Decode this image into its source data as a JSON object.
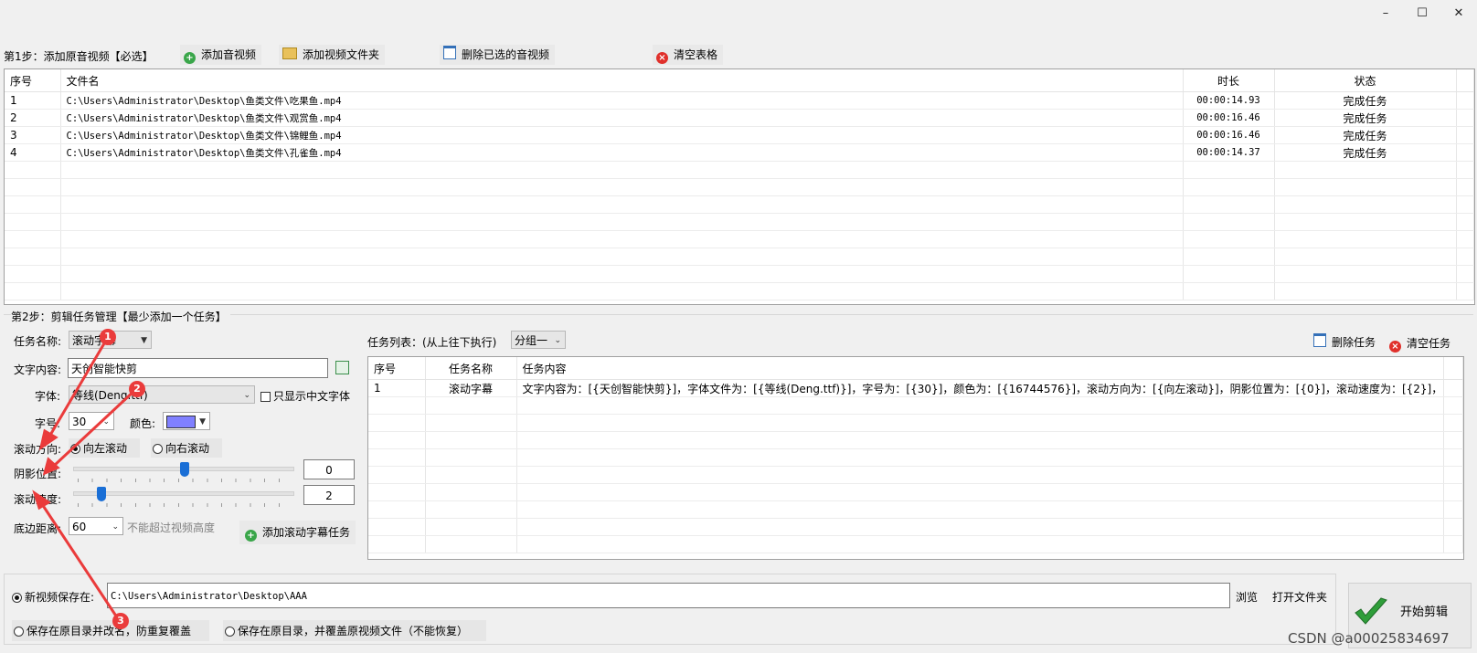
{
  "window": {
    "minimize_glyph": "–",
    "maximize_glyph": "☐",
    "close_glyph": "✕"
  },
  "step1": {
    "label": "第1步：添加原音视频【必选】",
    "add_av_label": "添加音视频",
    "add_folder_label": "添加视频文件夹",
    "delete_selected_label": "删除已选的音视频",
    "clear_table_label": "清空表格",
    "columns": [
      "序号",
      "文件名",
      "时长",
      "状态"
    ],
    "rows": [
      {
        "no": "1",
        "file": "C:\\Users\\Administrator\\Desktop\\鱼类文件\\吃果鱼.mp4",
        "duration": "00:00:14.93",
        "status": "完成任务"
      },
      {
        "no": "2",
        "file": "C:\\Users\\Administrator\\Desktop\\鱼类文件\\观赏鱼.mp4",
        "duration": "00:00:16.46",
        "status": "完成任务"
      },
      {
        "no": "3",
        "file": "C:\\Users\\Administrator\\Desktop\\鱼类文件\\锦鲤鱼.mp4",
        "duration": "00:00:16.46",
        "status": "完成任务"
      },
      {
        "no": "4",
        "file": "C:\\Users\\Administrator\\Desktop\\鱼类文件\\孔雀鱼.mp4",
        "duration": "00:00:14.37",
        "status": "完成任务"
      }
    ]
  },
  "step2": {
    "label": "第2步：剪辑任务管理【最少添加一个任务】",
    "task_name_label": "任务名称:",
    "task_name_value": "滚动字幕",
    "text_content_label": "文字内容:",
    "text_content_value": "天创智能快剪",
    "font_label": "字体:",
    "font_value": "等线(Deng.ttf)",
    "chinese_only_label": "只显示中文字体",
    "size_label": "字号:",
    "size_value": "30",
    "color_label": "颜色:",
    "color_value": "#8080ff",
    "direction_label": "滚动方向:",
    "dir_left_label": "向左滚动",
    "dir_right_label": "向右滚动",
    "shadow_label": "阴影位置:",
    "shadow_value": "0",
    "speed_label": "滚动速度:",
    "speed_value": "2",
    "bottom_label": "底边距离:",
    "bottom_value": "60",
    "bottom_hint": "不能超过视频高度",
    "add_task_label": "添加滚动字幕任务",
    "task_list_label": "任务列表：(从上往下执行)",
    "group_value": "分组一",
    "delete_task_label": "删除任务",
    "clear_tasks_label": "清空任务",
    "task_columns": [
      "序号",
      "任务名称",
      "任务内容"
    ],
    "tasks": [
      {
        "no": "1",
        "name": "滚动字幕",
        "content": "文字内容为：[{天创智能快剪}]，字体文件为：[{等线(Deng.ttf)}]，字号为：[{30}]，颜色为：[{16744576}]，滚动方向为：[{向左滚动}]，阴影位置为：[{0}]，滚动速度为：[{2}]，..."
      }
    ]
  },
  "output": {
    "new_save_label": "新视频保存在:",
    "path_value": "C:\\Users\\Administrator\\Desktop\\AAA",
    "browse_label": "浏览",
    "open_folder_label": "打开文件夹",
    "orig_rename_label": "保存在原目录并改名，防重复覆盖",
    "orig_overwrite_label": "保存在原目录，并覆盖原视频文件（不能恢复）",
    "start_label": "开始剪辑"
  },
  "annotations": [
    "1",
    "2",
    "3"
  ],
  "watermark": "CSDN @a00025834697",
  "colors": {
    "accent_blue": "#1a6fd6",
    "annotation_red": "#ea3b3b",
    "start_check_green": "#2f9e3a"
  }
}
